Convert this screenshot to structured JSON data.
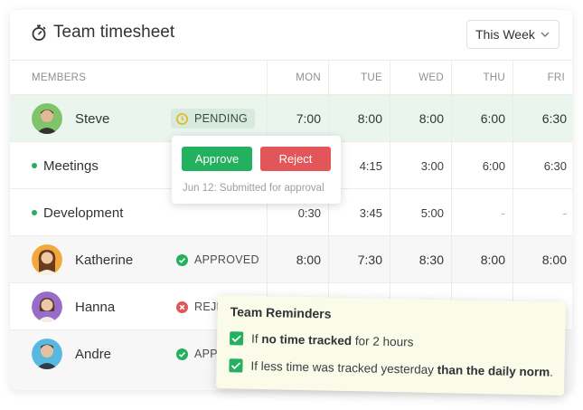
{
  "header": {
    "title": "Team timesheet",
    "week_select": "This Week"
  },
  "columns": {
    "members": "MEMBERS",
    "days": [
      "MON",
      "TUE",
      "WED",
      "THU",
      "FRI"
    ]
  },
  "rows": [
    {
      "name": "Steve",
      "status": "PENDING",
      "times": [
        "7:00",
        "8:00",
        "8:00",
        "6:00",
        "6:30"
      ]
    },
    {
      "name": "Meetings",
      "times": [
        "",
        "4:15",
        "3:00",
        "6:00",
        "6:30"
      ]
    },
    {
      "name": "Development",
      "times": [
        "0:30",
        "3:45",
        "5:00",
        "-",
        "-"
      ]
    },
    {
      "name": "Katherine",
      "status": "APPROVED",
      "times": [
        "8:00",
        "7:30",
        "8:30",
        "8:00",
        "8:00"
      ]
    },
    {
      "name": "Hanna",
      "status": "REJEC"
    },
    {
      "name": "Andre",
      "status": "APP"
    }
  ],
  "popover": {
    "approve": "Approve",
    "reject": "Reject",
    "note": "Jun 12: Submitted for approval"
  },
  "reminders": {
    "title": "Team Reminders",
    "item1": {
      "pre": "If ",
      "bold": "no time tracked",
      "post": " for 2 hours"
    },
    "item2": {
      "pre": "If less time was tracked yesterday ",
      "bold": "than the daily norm",
      "post": "."
    }
  },
  "colors": {
    "accent_green": "#23b05f",
    "reject_red": "#e25558",
    "pending_yellow": "#e0b91a",
    "highlight_row": "#eaf5ee",
    "note_bg": "#fbfbe9"
  },
  "icons": {
    "title": "stopwatch-icon",
    "select": "chevron-down-icon",
    "pending": "clock-icon",
    "approved": "check-circle-icon",
    "rejected": "x-circle-icon",
    "reminder": "checkbox-icon"
  }
}
